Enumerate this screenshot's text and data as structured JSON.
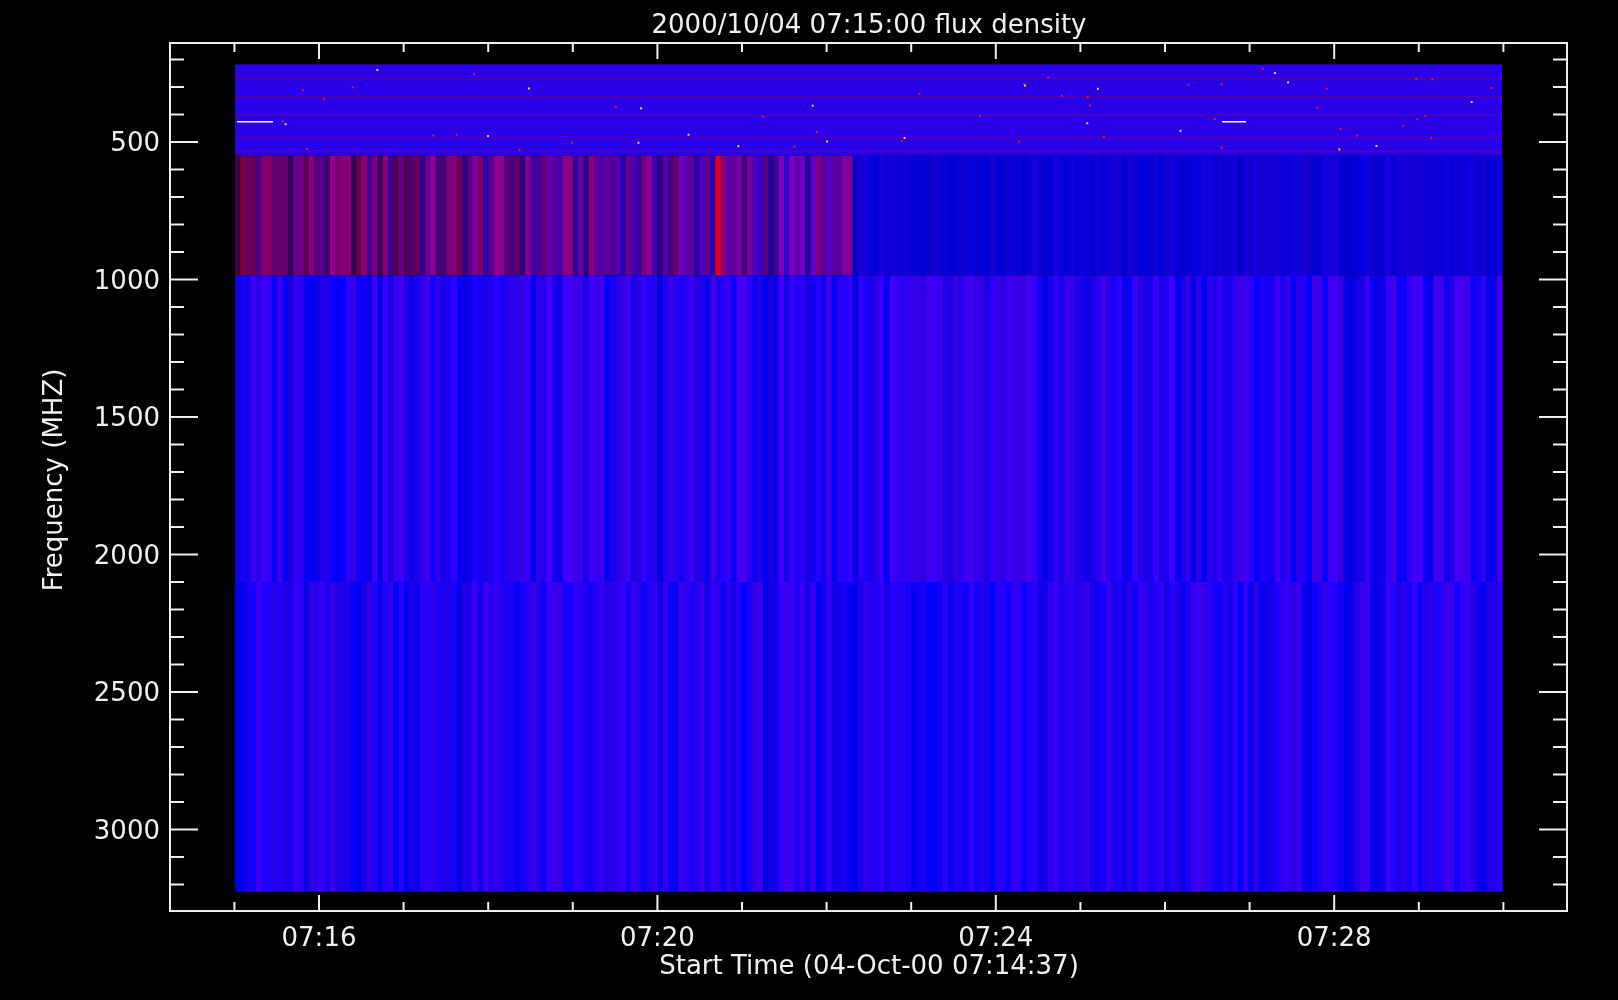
{
  "title": "2000/10/04 07:15:00 flux density",
  "x_axis": {
    "label": "Start Time (04-Oct-00 07:14:37)",
    "tick_labels": [
      "07:16",
      "07:20",
      "07:24",
      "07:28"
    ]
  },
  "y_axis": {
    "label": "Frequency (MHZ)",
    "tick_labels": [
      "500",
      "1000",
      "1500",
      "2000",
      "2500",
      "3000"
    ]
  }
}
